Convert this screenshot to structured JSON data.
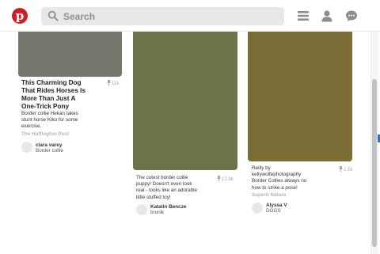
{
  "header": {
    "logo_letter": "p",
    "search": {
      "placeholder": "Search",
      "value": ""
    },
    "icons": [
      "menu-icon",
      "profile-icon",
      "messages-icon"
    ]
  },
  "pins": [
    {
      "image_color": "#77786d",
      "title": [
        "This Charming Dog",
        "That Rides Horses Is",
        "More Than Just A",
        "One-Trick Pony"
      ],
      "repins": "11k",
      "description": [
        "Border collie Hekan takes",
        "stunt horse Kiko for some",
        "exercise."
      ],
      "source": "The Huffington Post",
      "user": "clara varey",
      "board": "Border collie"
    },
    {
      "image_color": "#6b7447",
      "title": [],
      "repins": "13.8k",
      "description": [
        "The cutest border collie",
        "puppy! Doesn't even look",
        "real - looks like an adorable",
        "little stuffed toy!"
      ],
      "source": "",
      "user": "Katalin Bencze",
      "board": "brunik"
    },
    {
      "image_color": "#7b6c36",
      "title": [],
      "repins": "1.5k",
      "description": [
        "Reilly by",
        "kellywolfephotography",
        "Border Collies always no",
        "how to strike a pose!"
      ],
      "source": "Superb Nature",
      "user": "Alyssa V",
      "board": "DOGS"
    }
  ]
}
